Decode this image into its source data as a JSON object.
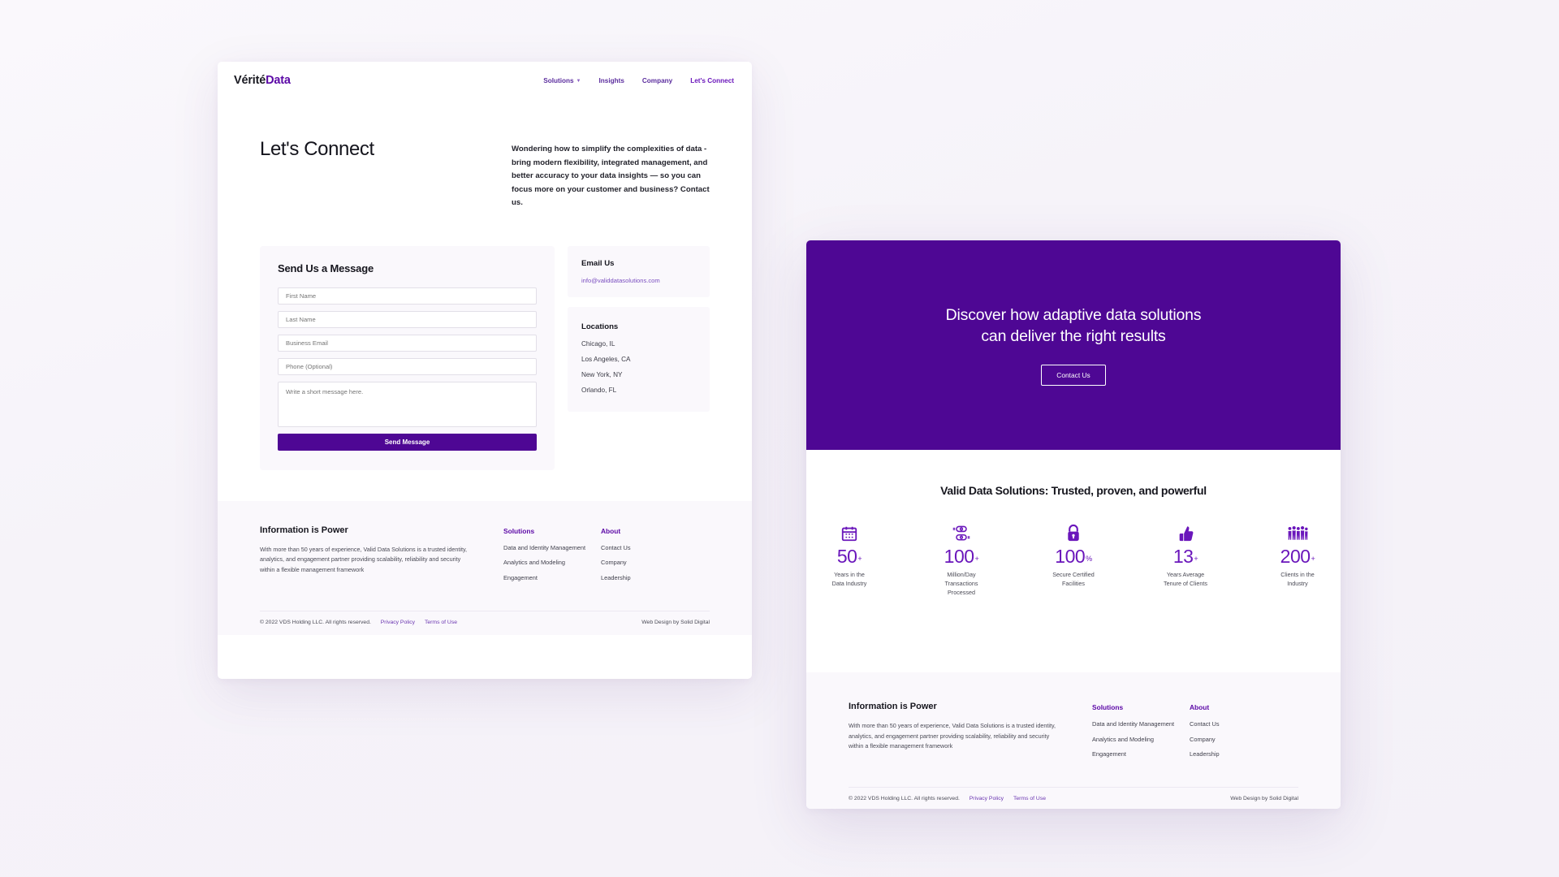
{
  "brand": {
    "name_dark": "Vérité",
    "name_accent": "Data",
    "accent_color": "#5b08a6"
  },
  "nav": {
    "items": [
      {
        "label": "Solutions",
        "has_dropdown": true
      },
      {
        "label": "Insights",
        "has_dropdown": false
      },
      {
        "label": "Company",
        "has_dropdown": false
      },
      {
        "label": "Let's Connect",
        "has_dropdown": false
      }
    ]
  },
  "hero": {
    "title": "Let's Connect",
    "paragraph": "Wondering how to simplify the complexities of data - bring modern flexibility, integrated management, and better accuracy to your data insights — so you can focus more on your customer and business? Contact us."
  },
  "form": {
    "title": "Send Us a Message",
    "fields": [
      {
        "name": "first-name",
        "placeholder": "First Name"
      },
      {
        "name": "last-name",
        "placeholder": "Last Name"
      },
      {
        "name": "business-email",
        "placeholder": "Business Email"
      },
      {
        "name": "phone",
        "placeholder": "Phone (Optional)"
      }
    ],
    "message_placeholder": "Write a short message here.",
    "submit_label": "Send Message",
    "submit_color": "#4e0794"
  },
  "contact": {
    "email_heading": "Email Us",
    "email": "info@validdatasolutions.com",
    "locations_heading": "Locations",
    "locations": [
      "Chicago, IL",
      "Los Angeles, CA",
      "New York, NY",
      "Orlando, FL"
    ]
  },
  "cta": {
    "heading_line1": "Discover how adaptive data solutions",
    "heading_line2": "can deliver the right results",
    "button_label": "Contact Us",
    "background": "#4e0794"
  },
  "stats_section": {
    "heading": "Valid Data Solutions: Trusted, proven, and powerful",
    "items": [
      {
        "icon": "calendar-icon",
        "value": "50",
        "suffix": "+",
        "label_line1": "Years in the",
        "label_line2": "Data Industry"
      },
      {
        "icon": "transactions-icon",
        "value": "100",
        "suffix": "+",
        "label_line1": "Million/Day",
        "label_line2": "Transactions",
        "label_line3": "Processed"
      },
      {
        "icon": "lock-icon",
        "value": "100",
        "suffix": "%",
        "label_line1": "Secure Certified",
        "label_line2": "Facilities"
      },
      {
        "icon": "thumbs-up-icon",
        "value": "13",
        "suffix": "+",
        "label_line1": "Years Average",
        "label_line2": "Tenure of Clients"
      },
      {
        "icon": "people-icon",
        "value": "200",
        "suffix": "+",
        "label_line1": "Clients in the",
        "label_line2": "Industry"
      }
    ]
  },
  "footer": {
    "about_title": "Information is Power",
    "about_text": "With more than 50 years of experience, Valid Data Solutions is a trusted identity, analytics, and engagement partner providing scalability, reliability and security within a flexible management framework",
    "solutions_heading": "Solutions",
    "solutions_links": [
      "Data and Identity Management",
      "Analytics and Modeling",
      "Engagement"
    ],
    "about_heading": "About",
    "about_links": [
      "Contact Us",
      "Company",
      "Leadership"
    ],
    "copyright": "© 2022 VDS Holding LLC. All rights reserved.",
    "privacy": "Privacy Policy",
    "terms": "Terms of Use",
    "credit": "Web Design by Solid Digital"
  }
}
